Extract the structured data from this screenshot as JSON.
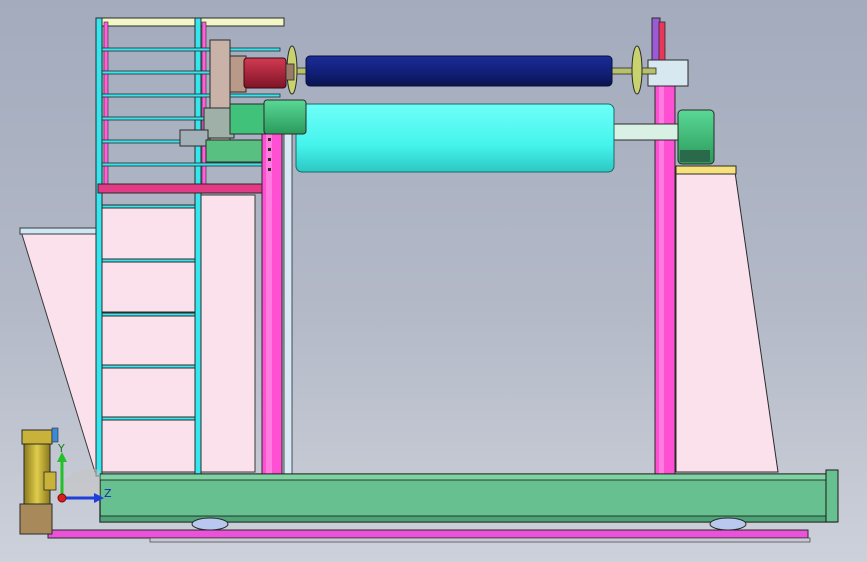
{
  "viewport": {
    "background_top": "#a3abbd",
    "background_bottom": "#cdd1da"
  },
  "triad": {
    "y_label": "Y",
    "z_label": "Z",
    "y_color": "#22c02a",
    "z_color": "#1e3fd8",
    "x_color": "#d81e1e"
  },
  "colors": {
    "frame_outline": "#2a2a2a",
    "ladder_cyan": "#35e6ee",
    "magenta_post": "#ff4fd3",
    "panel_pink": "#fbe1ec",
    "base_green": "#67c08f",
    "rail_magenta": "#ea53d9",
    "roller_cyan": "#4dfbf2",
    "roller_navy": "#12207a",
    "motor_red": "#b3243a",
    "gearbox_green": "#40c27a",
    "motor_gold": "#c9b23a",
    "bearing_khaki": "#b8c16a"
  }
}
